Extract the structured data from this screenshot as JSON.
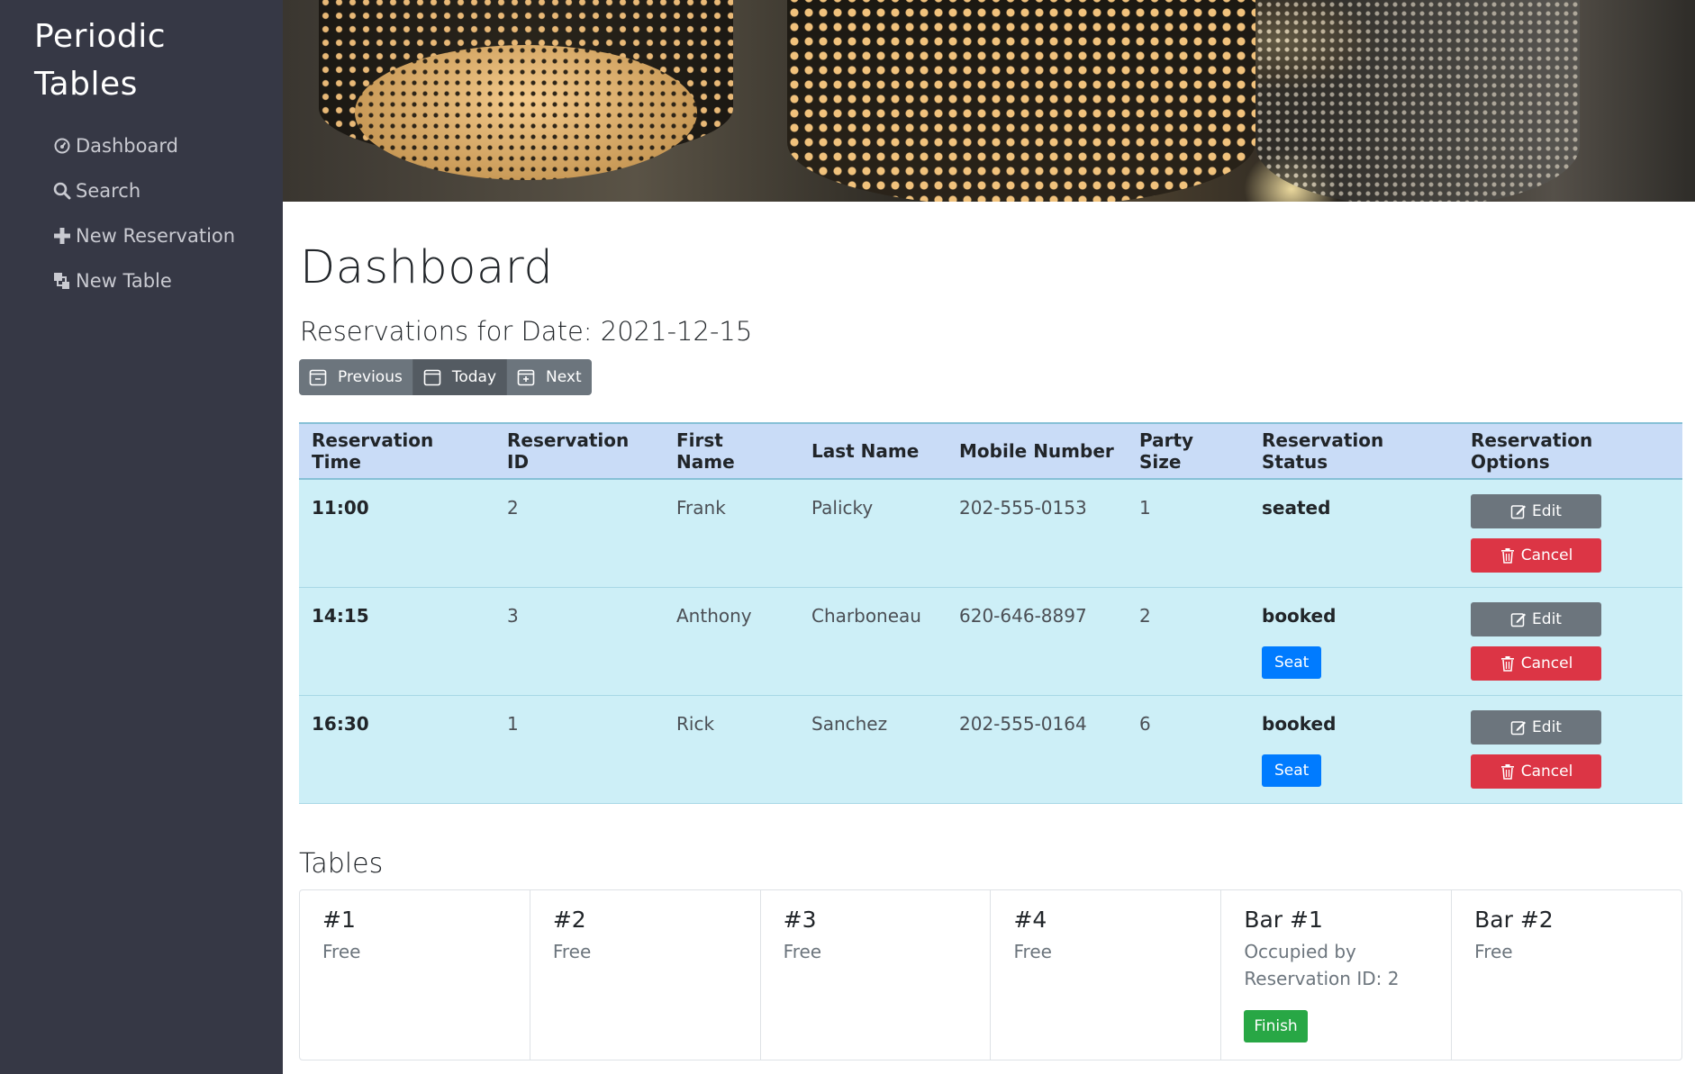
{
  "sidebar": {
    "brand_line1": "Periodic",
    "brand_line2": "Tables",
    "items": [
      {
        "label": "Dashboard",
        "icon": "dashboard-icon"
      },
      {
        "label": "Search",
        "icon": "search-icon"
      },
      {
        "label": "New Reservation",
        "icon": "plus-icon"
      },
      {
        "label": "New Table",
        "icon": "layers-icon"
      }
    ]
  },
  "header": {
    "title": "Dashboard",
    "subtitle": "Reservations for Date: 2021-12-15",
    "nav_buttons": [
      {
        "label": "Previous",
        "icon": "calendar-minus-icon"
      },
      {
        "label": "Today",
        "icon": "calendar-icon"
      },
      {
        "label": "Next",
        "icon": "calendar-plus-icon"
      }
    ]
  },
  "reservations": {
    "columns": [
      "Reservation Time",
      "Reservation ID",
      "First Name",
      "Last Name",
      "Mobile Number",
      "Party Size",
      "Reservation Status",
      "Reservation Options"
    ],
    "rows": [
      {
        "time": "11:00",
        "id": "2",
        "first": "Frank",
        "last": "Palicky",
        "mobile": "202-555-0153",
        "party": "1",
        "status": "seated",
        "seat_label": ""
      },
      {
        "time": "14:15",
        "id": "3",
        "first": "Anthony",
        "last": "Charboneau",
        "mobile": "620-646-8897",
        "party": "2",
        "status": "booked",
        "seat_label": "Seat"
      },
      {
        "time": "16:30",
        "id": "1",
        "first": "Rick",
        "last": "Sanchez",
        "mobile": "202-555-0164",
        "party": "6",
        "status": "booked",
        "seat_label": "Seat"
      }
    ],
    "edit_label": "Edit",
    "cancel_label": "Cancel"
  },
  "tables": {
    "title": "Tables",
    "items": [
      {
        "name": "#1",
        "status": "Free",
        "action": ""
      },
      {
        "name": "#2",
        "status": "Free",
        "action": ""
      },
      {
        "name": "#3",
        "status": "Free",
        "action": ""
      },
      {
        "name": "#4",
        "status": "Free",
        "action": ""
      },
      {
        "name": "Bar #1",
        "status": "Occupied by Reservation ID: 2",
        "action": "Finish"
      },
      {
        "name": "Bar #2",
        "status": "Free",
        "action": ""
      }
    ]
  },
  "colors": {
    "sidebar_bg": "#363845",
    "table_header_bg": "#c9dcf7",
    "table_row_bg": "#cdeff7",
    "seat_button": "#007bff",
    "edit_button": "#6c757d",
    "cancel_button": "#dc3545",
    "finish_button": "#28a745"
  }
}
